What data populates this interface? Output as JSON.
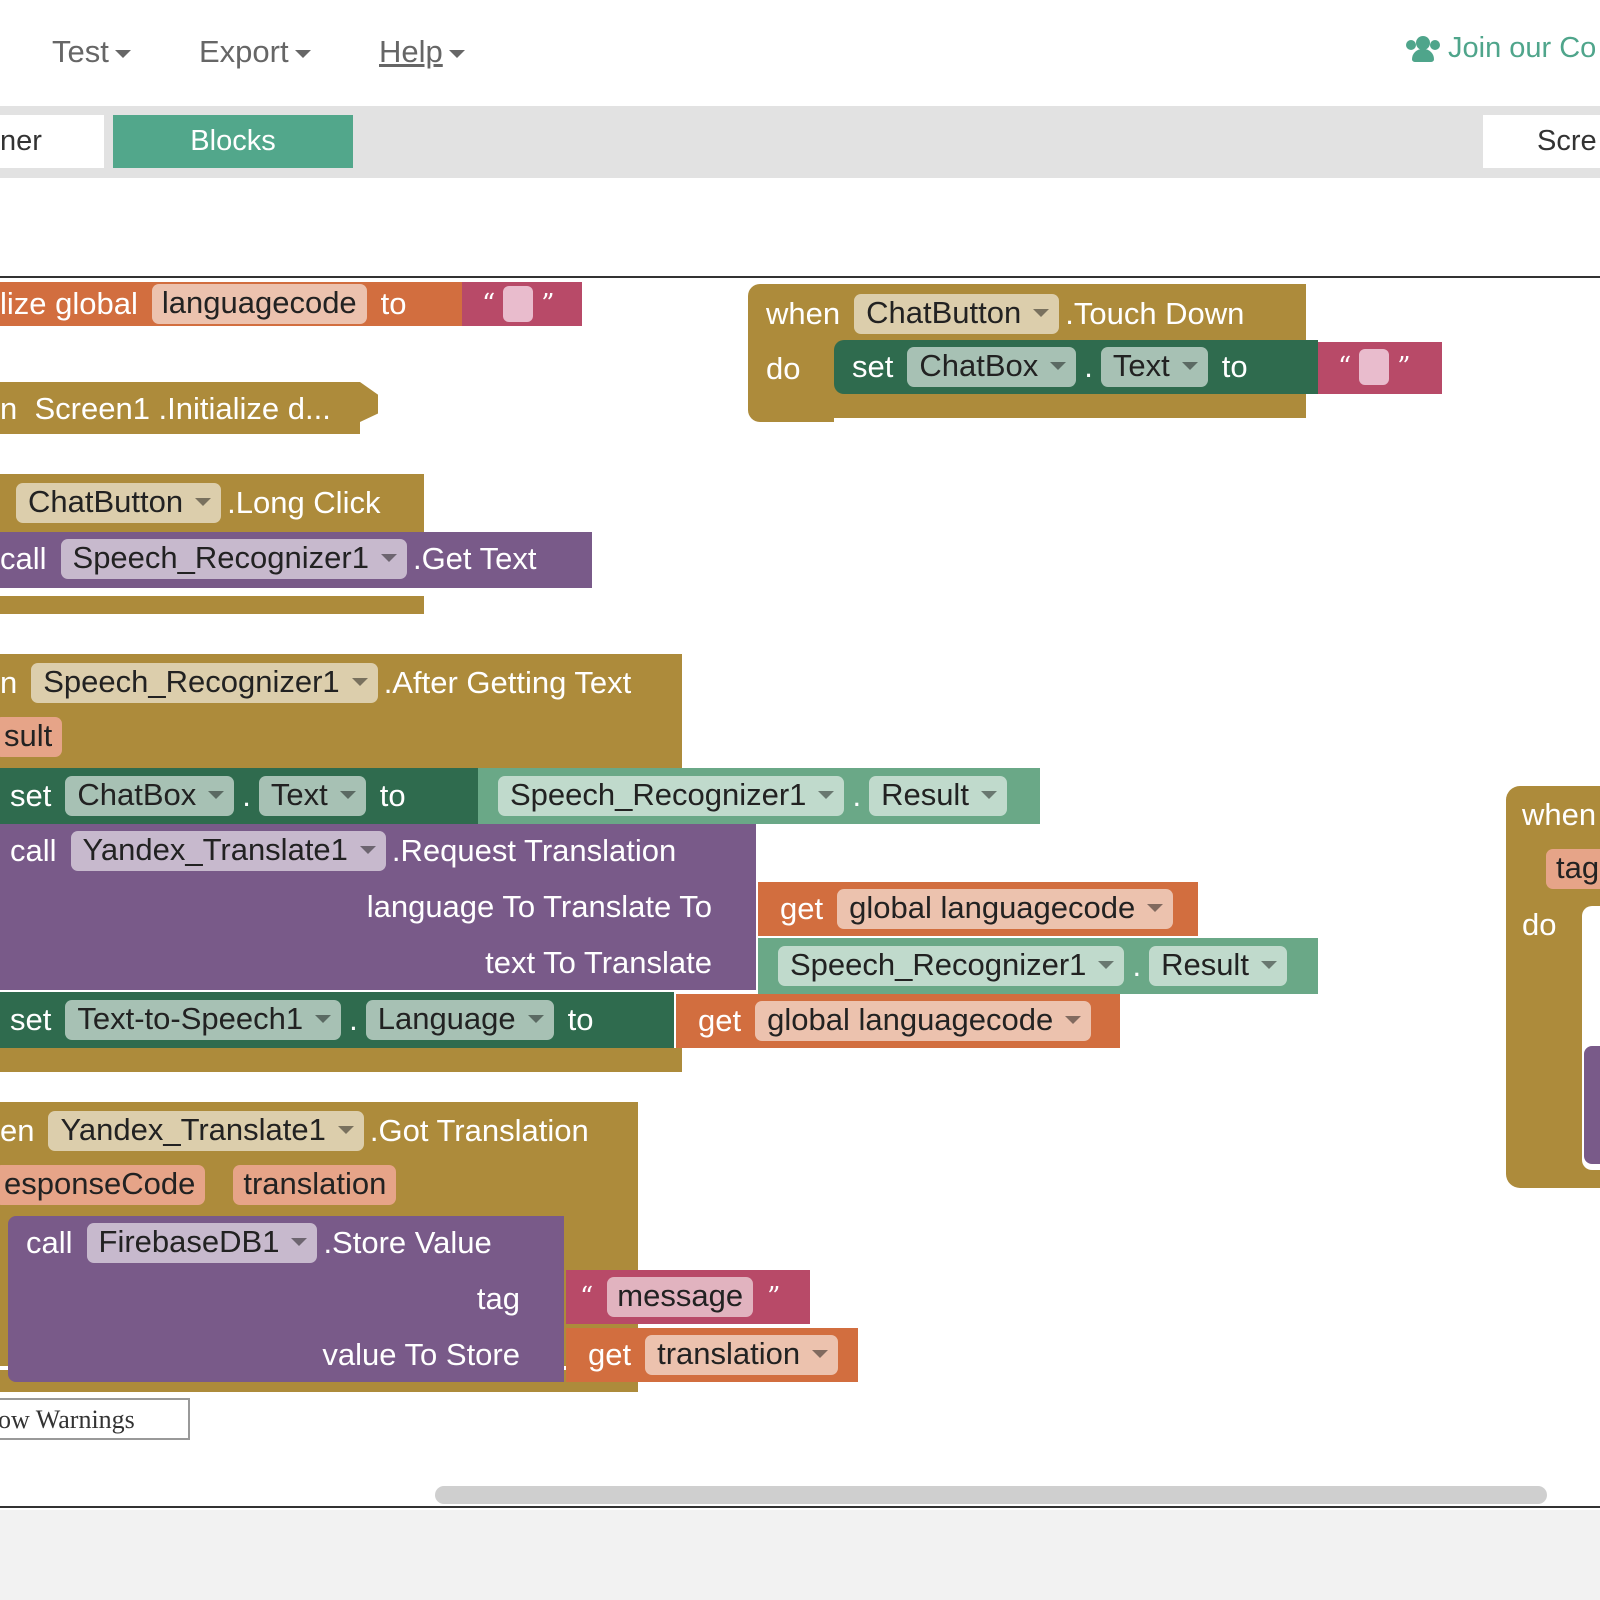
{
  "menu": {
    "test": "Test",
    "export": "Export",
    "help": "Help",
    "community": "Join our Co"
  },
  "tabs": {
    "designer": "ner",
    "blocks": "Blocks",
    "screen": "Scre"
  },
  "blocks": {
    "init_global": {
      "prefix": "lize global",
      "name": "languagecode",
      "to": "to",
      "q_open": "“",
      "q_close": "”"
    },
    "screen_init": {
      "label": "n  Screen1 .Initialize d..."
    },
    "touch_down": {
      "when": "when",
      "component": "ChatButton",
      "event": ".Touch Down",
      "do": "do",
      "set": "set",
      "target": "ChatBox",
      "dot": ".",
      "prop": "Text",
      "to": "to",
      "q_open": "“",
      "q_close": "”"
    },
    "long_click": {
      "component": "ChatButton",
      "event": ".Long Click",
      "call": "call",
      "target": "Speech_Recognizer1",
      "method": ".Get Text"
    },
    "after_text": {
      "prefix": "n",
      "component": "Speech_Recognizer1",
      "event": ".After Getting Text",
      "param": "sult",
      "set1": "set",
      "set1_target": "ChatBox",
      "dot": ".",
      "set1_prop": "Text",
      "to": "to",
      "val1_comp": "Speech_Recognizer1",
      "val1_prop": "Result",
      "call": "call",
      "call_target": "Yandex_Translate1",
      "call_method": ".Request Translation",
      "arg1_label": "language To Translate To",
      "get": "get",
      "arg1_var": "global languagecode",
      "arg2_label": "text To Translate",
      "arg2_comp": "Speech_Recognizer1",
      "arg2_prop": "Result",
      "set2": "set",
      "set2_target": "Text-to-Speech1",
      "set2_prop": "Language",
      "set2_var": "global languagecode"
    },
    "got_translation": {
      "prefix": "en",
      "component": "Yandex_Translate1",
      "event": ".Got Translation",
      "param1": "esponseCode",
      "param2": "translation",
      "call": "call",
      "call_target": "FirebaseDB1",
      "call_method": ".Store Value",
      "tag_label": "tag",
      "q_open": "“",
      "tag_value": "message",
      "q_close": "”",
      "value_label": "value To Store",
      "get": "get",
      "value_var": "translation"
    },
    "right_partial": {
      "when": "when",
      "tag": "tag",
      "do": "do"
    }
  },
  "warnings": "ow Warnings"
}
